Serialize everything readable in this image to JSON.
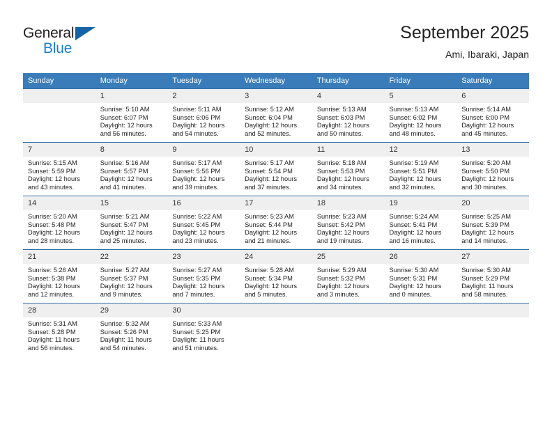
{
  "brand": {
    "name_top": "General",
    "name_bottom": "Blue",
    "accent_color": "#1b7fd4",
    "triangle_color": "#1464a5"
  },
  "header": {
    "title": "September 2025",
    "subtitle": "Ami, Ibaraki, Japan"
  },
  "theme": {
    "header_bg": "#3a7cb9",
    "header_text": "#ffffff",
    "daynum_bg": "#efefef",
    "rule_color": "#2f6ea5"
  },
  "weekday_headers": [
    "Sunday",
    "Monday",
    "Tuesday",
    "Wednesday",
    "Thursday",
    "Friday",
    "Saturday"
  ],
  "weeks": [
    [
      {
        "day": "",
        "sunrise": "",
        "sunset": "",
        "daylight_1": "",
        "daylight_2": ""
      },
      {
        "day": "1",
        "sunrise": "Sunrise: 5:10 AM",
        "sunset": "Sunset: 6:07 PM",
        "daylight_1": "Daylight: 12 hours",
        "daylight_2": "and 56 minutes."
      },
      {
        "day": "2",
        "sunrise": "Sunrise: 5:11 AM",
        "sunset": "Sunset: 6:06 PM",
        "daylight_1": "Daylight: 12 hours",
        "daylight_2": "and 54 minutes."
      },
      {
        "day": "3",
        "sunrise": "Sunrise: 5:12 AM",
        "sunset": "Sunset: 6:04 PM",
        "daylight_1": "Daylight: 12 hours",
        "daylight_2": "and 52 minutes."
      },
      {
        "day": "4",
        "sunrise": "Sunrise: 5:13 AM",
        "sunset": "Sunset: 6:03 PM",
        "daylight_1": "Daylight: 12 hours",
        "daylight_2": "and 50 minutes."
      },
      {
        "day": "5",
        "sunrise": "Sunrise: 5:13 AM",
        "sunset": "Sunset: 6:02 PM",
        "daylight_1": "Daylight: 12 hours",
        "daylight_2": "and 48 minutes."
      },
      {
        "day": "6",
        "sunrise": "Sunrise: 5:14 AM",
        "sunset": "Sunset: 6:00 PM",
        "daylight_1": "Daylight: 12 hours",
        "daylight_2": "and 45 minutes."
      }
    ],
    [
      {
        "day": "7",
        "sunrise": "Sunrise: 5:15 AM",
        "sunset": "Sunset: 5:59 PM",
        "daylight_1": "Daylight: 12 hours",
        "daylight_2": "and 43 minutes."
      },
      {
        "day": "8",
        "sunrise": "Sunrise: 5:16 AM",
        "sunset": "Sunset: 5:57 PM",
        "daylight_1": "Daylight: 12 hours",
        "daylight_2": "and 41 minutes."
      },
      {
        "day": "9",
        "sunrise": "Sunrise: 5:17 AM",
        "sunset": "Sunset: 5:56 PM",
        "daylight_1": "Daylight: 12 hours",
        "daylight_2": "and 39 minutes."
      },
      {
        "day": "10",
        "sunrise": "Sunrise: 5:17 AM",
        "sunset": "Sunset: 5:54 PM",
        "daylight_1": "Daylight: 12 hours",
        "daylight_2": "and 37 minutes."
      },
      {
        "day": "11",
        "sunrise": "Sunrise: 5:18 AM",
        "sunset": "Sunset: 5:53 PM",
        "daylight_1": "Daylight: 12 hours",
        "daylight_2": "and 34 minutes."
      },
      {
        "day": "12",
        "sunrise": "Sunrise: 5:19 AM",
        "sunset": "Sunset: 5:51 PM",
        "daylight_1": "Daylight: 12 hours",
        "daylight_2": "and 32 minutes."
      },
      {
        "day": "13",
        "sunrise": "Sunrise: 5:20 AM",
        "sunset": "Sunset: 5:50 PM",
        "daylight_1": "Daylight: 12 hours",
        "daylight_2": "and 30 minutes."
      }
    ],
    [
      {
        "day": "14",
        "sunrise": "Sunrise: 5:20 AM",
        "sunset": "Sunset: 5:48 PM",
        "daylight_1": "Daylight: 12 hours",
        "daylight_2": "and 28 minutes."
      },
      {
        "day": "15",
        "sunrise": "Sunrise: 5:21 AM",
        "sunset": "Sunset: 5:47 PM",
        "daylight_1": "Daylight: 12 hours",
        "daylight_2": "and 25 minutes."
      },
      {
        "day": "16",
        "sunrise": "Sunrise: 5:22 AM",
        "sunset": "Sunset: 5:45 PM",
        "daylight_1": "Daylight: 12 hours",
        "daylight_2": "and 23 minutes."
      },
      {
        "day": "17",
        "sunrise": "Sunrise: 5:23 AM",
        "sunset": "Sunset: 5:44 PM",
        "daylight_1": "Daylight: 12 hours",
        "daylight_2": "and 21 minutes."
      },
      {
        "day": "18",
        "sunrise": "Sunrise: 5:23 AM",
        "sunset": "Sunset: 5:42 PM",
        "daylight_1": "Daylight: 12 hours",
        "daylight_2": "and 19 minutes."
      },
      {
        "day": "19",
        "sunrise": "Sunrise: 5:24 AM",
        "sunset": "Sunset: 5:41 PM",
        "daylight_1": "Daylight: 12 hours",
        "daylight_2": "and 16 minutes."
      },
      {
        "day": "20",
        "sunrise": "Sunrise: 5:25 AM",
        "sunset": "Sunset: 5:39 PM",
        "daylight_1": "Daylight: 12 hours",
        "daylight_2": "and 14 minutes."
      }
    ],
    [
      {
        "day": "21",
        "sunrise": "Sunrise: 5:26 AM",
        "sunset": "Sunset: 5:38 PM",
        "daylight_1": "Daylight: 12 hours",
        "daylight_2": "and 12 minutes."
      },
      {
        "day": "22",
        "sunrise": "Sunrise: 5:27 AM",
        "sunset": "Sunset: 5:37 PM",
        "daylight_1": "Daylight: 12 hours",
        "daylight_2": "and 9 minutes."
      },
      {
        "day": "23",
        "sunrise": "Sunrise: 5:27 AM",
        "sunset": "Sunset: 5:35 PM",
        "daylight_1": "Daylight: 12 hours",
        "daylight_2": "and 7 minutes."
      },
      {
        "day": "24",
        "sunrise": "Sunrise: 5:28 AM",
        "sunset": "Sunset: 5:34 PM",
        "daylight_1": "Daylight: 12 hours",
        "daylight_2": "and 5 minutes."
      },
      {
        "day": "25",
        "sunrise": "Sunrise: 5:29 AM",
        "sunset": "Sunset: 5:32 PM",
        "daylight_1": "Daylight: 12 hours",
        "daylight_2": "and 3 minutes."
      },
      {
        "day": "26",
        "sunrise": "Sunrise: 5:30 AM",
        "sunset": "Sunset: 5:31 PM",
        "daylight_1": "Daylight: 12 hours",
        "daylight_2": "and 0 minutes."
      },
      {
        "day": "27",
        "sunrise": "Sunrise: 5:30 AM",
        "sunset": "Sunset: 5:29 PM",
        "daylight_1": "Daylight: 11 hours",
        "daylight_2": "and 58 minutes."
      }
    ],
    [
      {
        "day": "28",
        "sunrise": "Sunrise: 5:31 AM",
        "sunset": "Sunset: 5:28 PM",
        "daylight_1": "Daylight: 11 hours",
        "daylight_2": "and 56 minutes."
      },
      {
        "day": "29",
        "sunrise": "Sunrise: 5:32 AM",
        "sunset": "Sunset: 5:26 PM",
        "daylight_1": "Daylight: 11 hours",
        "daylight_2": "and 54 minutes."
      },
      {
        "day": "30",
        "sunrise": "Sunrise: 5:33 AM",
        "sunset": "Sunset: 5:25 PM",
        "daylight_1": "Daylight: 11 hours",
        "daylight_2": "and 51 minutes."
      },
      {
        "day": "",
        "sunrise": "",
        "sunset": "",
        "daylight_1": "",
        "daylight_2": ""
      },
      {
        "day": "",
        "sunrise": "",
        "sunset": "",
        "daylight_1": "",
        "daylight_2": ""
      },
      {
        "day": "",
        "sunrise": "",
        "sunset": "",
        "daylight_1": "",
        "daylight_2": ""
      },
      {
        "day": "",
        "sunrise": "",
        "sunset": "",
        "daylight_1": "",
        "daylight_2": ""
      }
    ]
  ]
}
